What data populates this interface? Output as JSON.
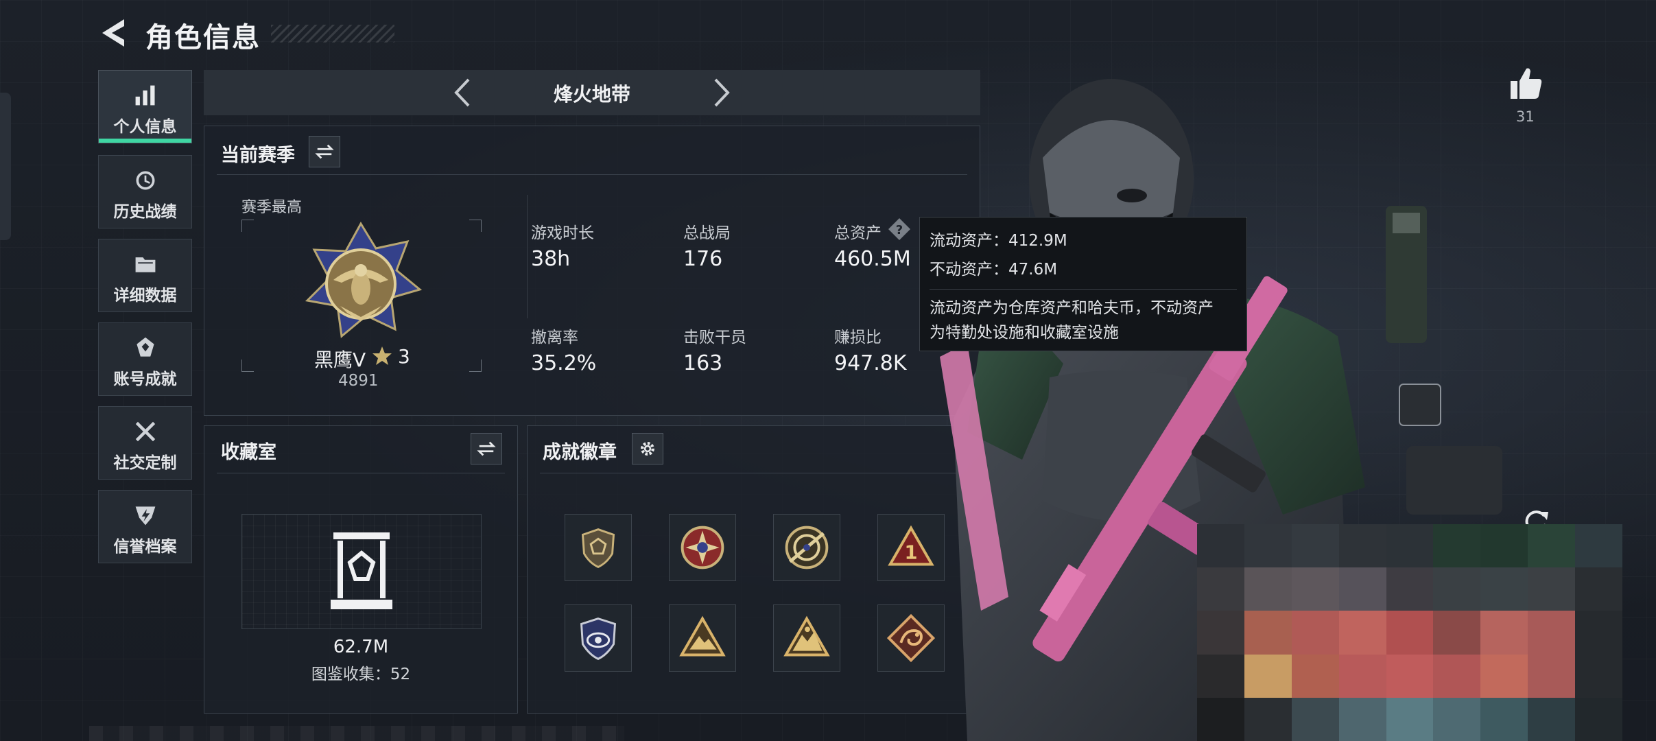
{
  "header": {
    "title": "角色信息"
  },
  "sidebar": {
    "items": [
      {
        "label": "个人信息",
        "icon": "bar-chart-icon",
        "active": true
      },
      {
        "label": "历史战绩",
        "icon": "clock-icon",
        "active": false
      },
      {
        "label": "详细数据",
        "icon": "folder-icon",
        "active": false
      },
      {
        "label": "账号成就",
        "icon": "medal-icon",
        "active": false
      },
      {
        "label": "社交定制",
        "icon": "tools-icon",
        "active": false
      },
      {
        "label": "信誉档案",
        "icon": "shield-icon",
        "active": false
      }
    ]
  },
  "mode": {
    "title": "烽火地带"
  },
  "season": {
    "title": "当前赛季",
    "best_label": "赛季最高",
    "rank_name": "黑鹰V",
    "rank_stars": "3",
    "rank_score": "4891",
    "stats": [
      {
        "label": "游戏时长",
        "value": "38h"
      },
      {
        "label": "总战局",
        "value": "176"
      },
      {
        "label": "总资产",
        "value": "460.5M"
      },
      {
        "label": "撤离率",
        "value": "35.2%"
      },
      {
        "label": "击败干员",
        "value": "163"
      },
      {
        "label": "赚损比",
        "value": "947.8K"
      }
    ]
  },
  "tooltip": {
    "liquid": "流动资产：412.9M",
    "fixed": "不动资产：47.6M",
    "desc_line1": "流动资产为仓库资产和哈夫币，不动资产",
    "desc_line2": "为特勤处设施和收藏室设施"
  },
  "collection": {
    "title": "收藏室",
    "value": "62.7M",
    "count_text": "图鉴收集：52"
  },
  "achievements": {
    "title": "成就徽章",
    "badges": [
      "shield-badge-icon",
      "star-compass-badge-icon",
      "target-badge-icon",
      "number-one-badge-icon",
      "eye-shield-badge-icon",
      "mountain-badge-icon",
      "mountain-climber-badge-icon",
      "dragon-badge-icon"
    ]
  },
  "likes": {
    "count": "31"
  },
  "colors": {
    "accent": "#3fd6a3",
    "background": "#1c2129",
    "panel_border": "#3a424c"
  }
}
